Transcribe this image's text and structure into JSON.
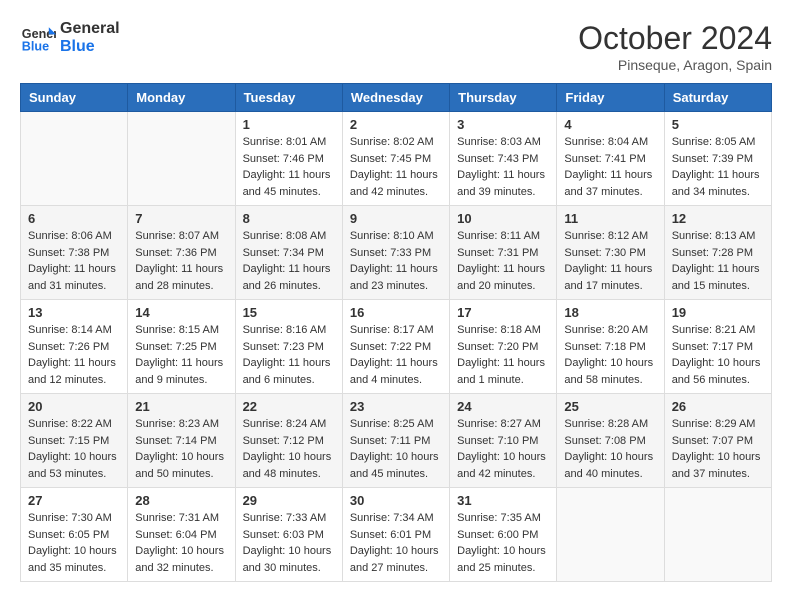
{
  "header": {
    "logo_line1": "General",
    "logo_line2": "Blue",
    "month": "October 2024",
    "location": "Pinseque, Aragon, Spain"
  },
  "weekdays": [
    "Sunday",
    "Monday",
    "Tuesday",
    "Wednesday",
    "Thursday",
    "Friday",
    "Saturday"
  ],
  "weeks": [
    [
      {
        "day": "",
        "info": ""
      },
      {
        "day": "",
        "info": ""
      },
      {
        "day": "1",
        "info": "Sunrise: 8:01 AM\nSunset: 7:46 PM\nDaylight: 11 hours and 45 minutes."
      },
      {
        "day": "2",
        "info": "Sunrise: 8:02 AM\nSunset: 7:45 PM\nDaylight: 11 hours and 42 minutes."
      },
      {
        "day": "3",
        "info": "Sunrise: 8:03 AM\nSunset: 7:43 PM\nDaylight: 11 hours and 39 minutes."
      },
      {
        "day": "4",
        "info": "Sunrise: 8:04 AM\nSunset: 7:41 PM\nDaylight: 11 hours and 37 minutes."
      },
      {
        "day": "5",
        "info": "Sunrise: 8:05 AM\nSunset: 7:39 PM\nDaylight: 11 hours and 34 minutes."
      }
    ],
    [
      {
        "day": "6",
        "info": "Sunrise: 8:06 AM\nSunset: 7:38 PM\nDaylight: 11 hours and 31 minutes."
      },
      {
        "day": "7",
        "info": "Sunrise: 8:07 AM\nSunset: 7:36 PM\nDaylight: 11 hours and 28 minutes."
      },
      {
        "day": "8",
        "info": "Sunrise: 8:08 AM\nSunset: 7:34 PM\nDaylight: 11 hours and 26 minutes."
      },
      {
        "day": "9",
        "info": "Sunrise: 8:10 AM\nSunset: 7:33 PM\nDaylight: 11 hours and 23 minutes."
      },
      {
        "day": "10",
        "info": "Sunrise: 8:11 AM\nSunset: 7:31 PM\nDaylight: 11 hours and 20 minutes."
      },
      {
        "day": "11",
        "info": "Sunrise: 8:12 AM\nSunset: 7:30 PM\nDaylight: 11 hours and 17 minutes."
      },
      {
        "day": "12",
        "info": "Sunrise: 8:13 AM\nSunset: 7:28 PM\nDaylight: 11 hours and 15 minutes."
      }
    ],
    [
      {
        "day": "13",
        "info": "Sunrise: 8:14 AM\nSunset: 7:26 PM\nDaylight: 11 hours and 12 minutes."
      },
      {
        "day": "14",
        "info": "Sunrise: 8:15 AM\nSunset: 7:25 PM\nDaylight: 11 hours and 9 minutes."
      },
      {
        "day": "15",
        "info": "Sunrise: 8:16 AM\nSunset: 7:23 PM\nDaylight: 11 hours and 6 minutes."
      },
      {
        "day": "16",
        "info": "Sunrise: 8:17 AM\nSunset: 7:22 PM\nDaylight: 11 hours and 4 minutes."
      },
      {
        "day": "17",
        "info": "Sunrise: 8:18 AM\nSunset: 7:20 PM\nDaylight: 11 hours and 1 minute."
      },
      {
        "day": "18",
        "info": "Sunrise: 8:20 AM\nSunset: 7:18 PM\nDaylight: 10 hours and 58 minutes."
      },
      {
        "day": "19",
        "info": "Sunrise: 8:21 AM\nSunset: 7:17 PM\nDaylight: 10 hours and 56 minutes."
      }
    ],
    [
      {
        "day": "20",
        "info": "Sunrise: 8:22 AM\nSunset: 7:15 PM\nDaylight: 10 hours and 53 minutes."
      },
      {
        "day": "21",
        "info": "Sunrise: 8:23 AM\nSunset: 7:14 PM\nDaylight: 10 hours and 50 minutes."
      },
      {
        "day": "22",
        "info": "Sunrise: 8:24 AM\nSunset: 7:12 PM\nDaylight: 10 hours and 48 minutes."
      },
      {
        "day": "23",
        "info": "Sunrise: 8:25 AM\nSunset: 7:11 PM\nDaylight: 10 hours and 45 minutes."
      },
      {
        "day": "24",
        "info": "Sunrise: 8:27 AM\nSunset: 7:10 PM\nDaylight: 10 hours and 42 minutes."
      },
      {
        "day": "25",
        "info": "Sunrise: 8:28 AM\nSunset: 7:08 PM\nDaylight: 10 hours and 40 minutes."
      },
      {
        "day": "26",
        "info": "Sunrise: 8:29 AM\nSunset: 7:07 PM\nDaylight: 10 hours and 37 minutes."
      }
    ],
    [
      {
        "day": "27",
        "info": "Sunrise: 7:30 AM\nSunset: 6:05 PM\nDaylight: 10 hours and 35 minutes."
      },
      {
        "day": "28",
        "info": "Sunrise: 7:31 AM\nSunset: 6:04 PM\nDaylight: 10 hours and 32 minutes."
      },
      {
        "day": "29",
        "info": "Sunrise: 7:33 AM\nSunset: 6:03 PM\nDaylight: 10 hours and 30 minutes."
      },
      {
        "day": "30",
        "info": "Sunrise: 7:34 AM\nSunset: 6:01 PM\nDaylight: 10 hours and 27 minutes."
      },
      {
        "day": "31",
        "info": "Sunrise: 7:35 AM\nSunset: 6:00 PM\nDaylight: 10 hours and 25 minutes."
      },
      {
        "day": "",
        "info": ""
      },
      {
        "day": "",
        "info": ""
      }
    ]
  ]
}
